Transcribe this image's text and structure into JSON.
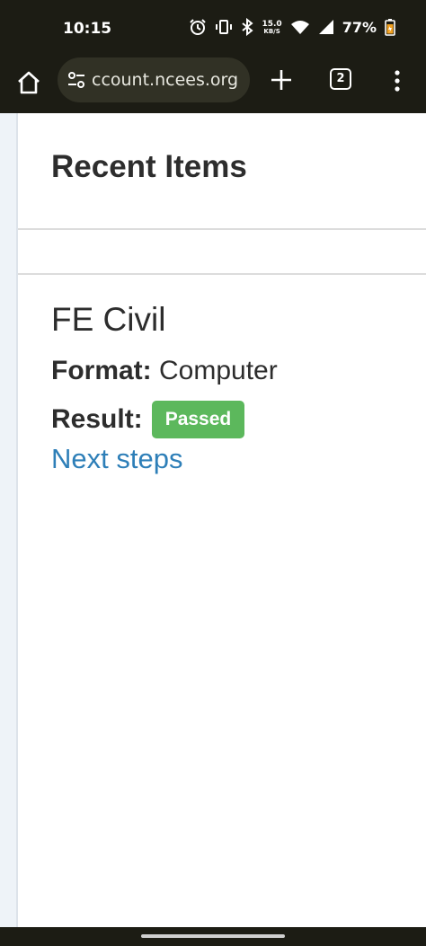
{
  "status_bar": {
    "time": "10:15",
    "net_speed_value": "15.0",
    "net_speed_unit": "KB/S",
    "battery": "77%",
    "icons": [
      "alarm-icon",
      "vibrate-icon",
      "bluetooth-icon",
      "wifi-icon",
      "signal-icon",
      "battery-icon"
    ]
  },
  "browser": {
    "url": "ccount.ncees.org",
    "tab_count": "2",
    "icons": [
      "home-icon",
      "site-settings-icon",
      "plus-icon",
      "more-vert-icon"
    ]
  },
  "page": {
    "section_title": "Recent Items",
    "item": {
      "title": "FE Civil",
      "format_label": "Format:",
      "format_value": "Computer",
      "result_label": "Result:",
      "result_value": "Passed",
      "next_link": "Next steps"
    }
  },
  "colors": {
    "system_bar": "#1c1c14",
    "badge_success": "#5cb85c",
    "link": "#2e7fb8",
    "text": "#2d2d2d"
  }
}
